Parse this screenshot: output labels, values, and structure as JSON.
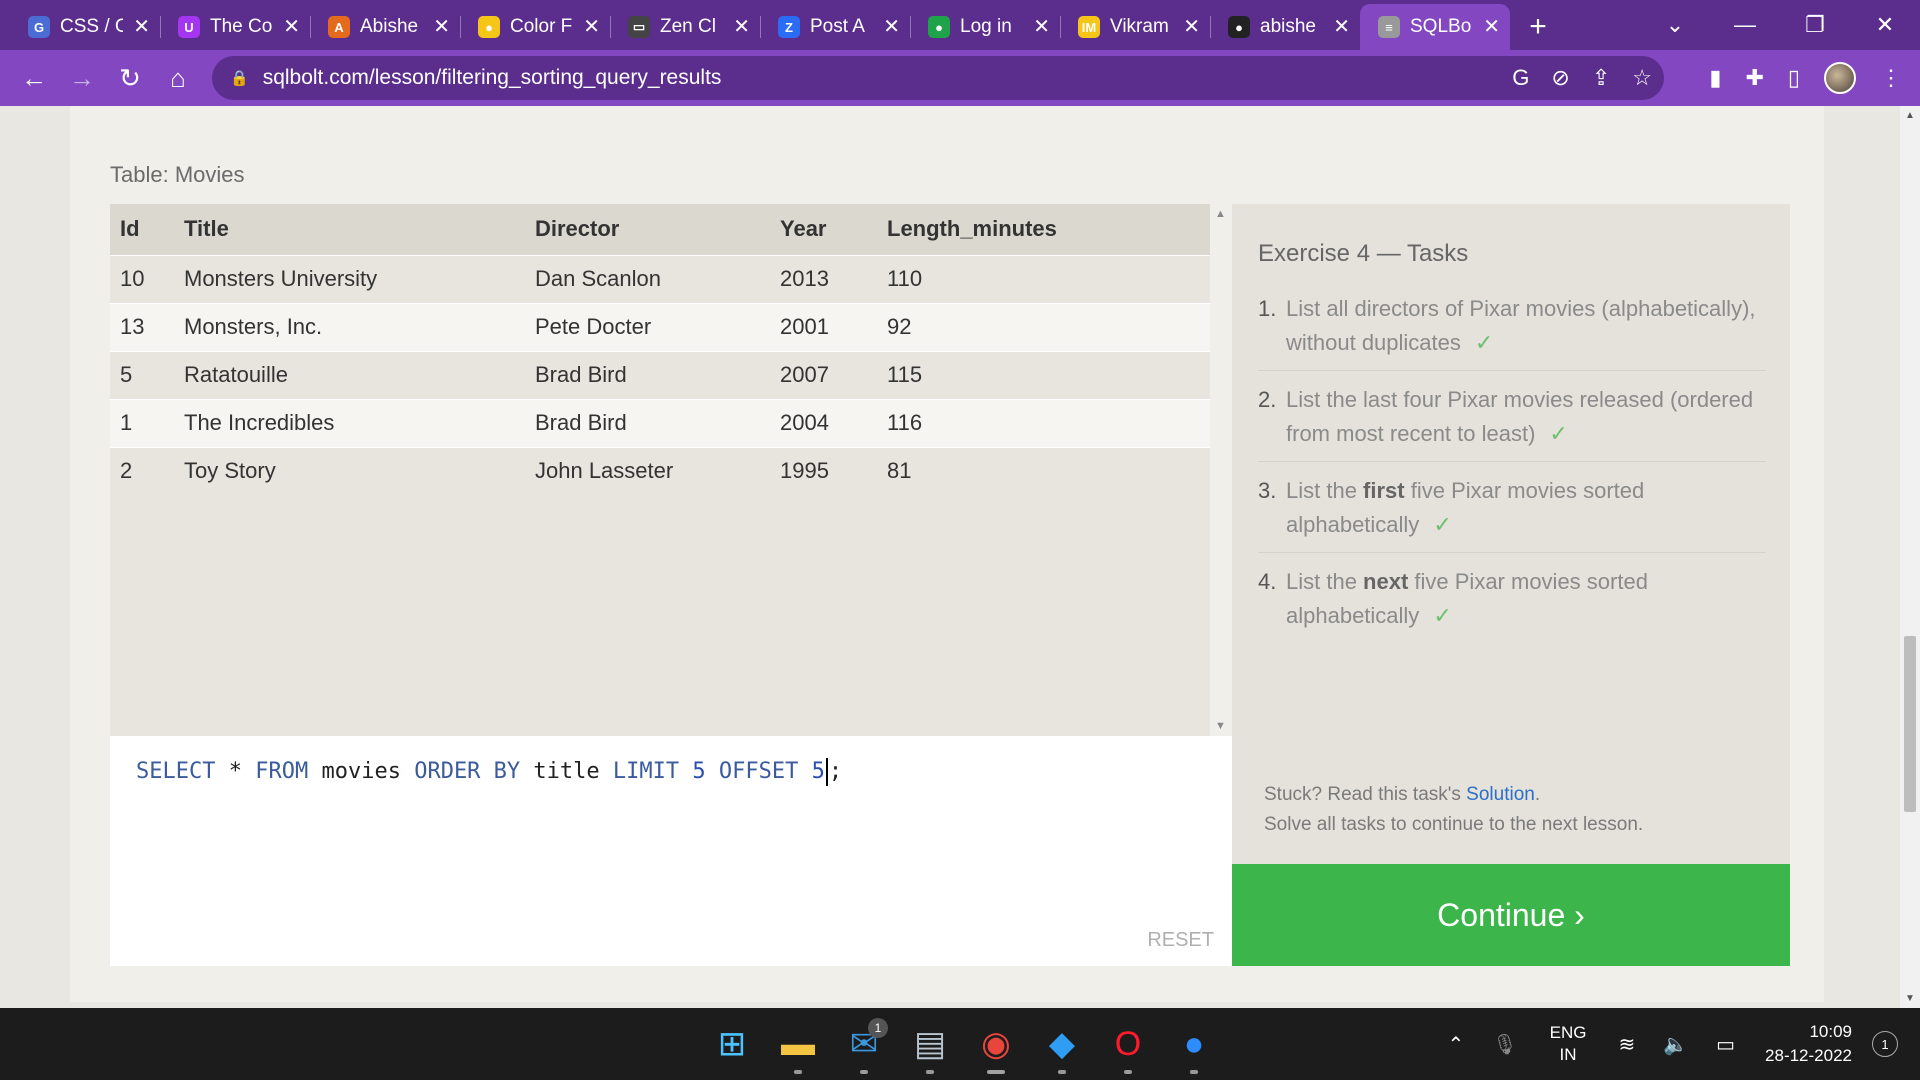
{
  "browser": {
    "tabs": [
      {
        "title": "CSS / C",
        "icon": "google-translate-icon",
        "color": "#4a6cd4",
        "glyph": "G"
      },
      {
        "title": "The Co",
        "icon": "udemy-icon",
        "color": "#a435f0",
        "glyph": "U"
      },
      {
        "title": "Abishe",
        "icon": "letter-a-icon",
        "color": "#e46a1c",
        "glyph": "A"
      },
      {
        "title": "Color F",
        "icon": "color-palette-icon",
        "color": "#f5c518",
        "glyph": "●"
      },
      {
        "title": "Zen Cl",
        "icon": "zen-class-icon",
        "color": "#444444",
        "glyph": "▭"
      },
      {
        "title": "Post A",
        "icon": "zoho-z-icon",
        "color": "#2a6df4",
        "glyph": "Z"
      },
      {
        "title": "Log in",
        "icon": "mongodb-leaf-icon",
        "color": "#1fa34a",
        "glyph": "●"
      },
      {
        "title": "Vikram",
        "icon": "imdb-icon",
        "color": "#f5c518",
        "glyph": "IM"
      },
      {
        "title": "abishe",
        "icon": "github-icon",
        "color": "#222222",
        "glyph": "●"
      },
      {
        "title": "SQLBo",
        "icon": "database-icon",
        "color": "#999999",
        "glyph": "≡"
      }
    ],
    "url": "sqlbolt.com/lesson/filtering_sorting_query_results"
  },
  "page": {
    "table_label": "Table: Movies",
    "columns": [
      "Id",
      "Title",
      "Director",
      "Year",
      "Length_minutes"
    ],
    "rows": [
      [
        "10",
        "Monsters University",
        "Dan Scanlon",
        "2013",
        "110"
      ],
      [
        "13",
        "Monsters, Inc.",
        "Pete Docter",
        "2001",
        "92"
      ],
      [
        "5",
        "Ratatouille",
        "Brad Bird",
        "2007",
        "115"
      ],
      [
        "1",
        "The Incredibles",
        "Brad Bird",
        "2004",
        "116"
      ],
      [
        "2",
        "Toy Story",
        "John Lasseter",
        "1995",
        "81"
      ]
    ],
    "query": {
      "kw_select": "SELECT",
      "star": "*",
      "kw_from": "FROM",
      "table": "movies",
      "kw_order_by": "ORDER BY",
      "column": "title",
      "kw_limit": "LIMIT",
      "limit_value": "5",
      "kw_offset": "OFFSET",
      "offset_value": "5",
      "terminator": ";"
    },
    "reset_label": "RESET",
    "exercise": {
      "title": "Exercise 4 — Tasks",
      "tasks": [
        {
          "num": "1.",
          "before": "List all directors of Pixar movies (alphabetically), without duplicates",
          "bold": "",
          "after": "",
          "check": "✓"
        },
        {
          "num": "2.",
          "before": "List the last four Pixar movies released (ordered from most recent to least)",
          "bold": "",
          "after": "",
          "check": "✓"
        },
        {
          "num": "3.",
          "before": "List the ",
          "bold": "first",
          "after": " five Pixar movies sorted alphabetically",
          "check": "✓"
        },
        {
          "num": "4.",
          "before": "List the ",
          "bold": "next",
          "after": " five Pixar movies sorted alphabetically",
          "check": "✓"
        }
      ],
      "stuck_text": "Stuck? Read this task's ",
      "solution_link": "Solution",
      "stuck_period": ".",
      "solve_text": "Solve all tasks to continue to the next lesson.",
      "continue_label": "Continue ›"
    }
  },
  "taskbar": {
    "apps": [
      {
        "name": "windows-start-icon",
        "glyph": "⊞",
        "color": "#4cc2ff"
      },
      {
        "name": "file-explorer-icon",
        "glyph": "▬",
        "color": "#f4c542"
      },
      {
        "name": "mail-icon",
        "glyph": "✉",
        "color": "#3a96dd",
        "badge": "1"
      },
      {
        "name": "keyboard-app-icon",
        "glyph": "▤",
        "color": "#b8c4d0"
      },
      {
        "name": "chrome-icon",
        "glyph": "◉",
        "color": "#e8453c"
      },
      {
        "name": "vscode-icon",
        "glyph": "◆",
        "color": "#2f9df4"
      },
      {
        "name": "opera-icon",
        "glyph": "O",
        "color": "#ff1b2d"
      },
      {
        "name": "zoom-icon",
        "glyph": "●",
        "color": "#2d8cff"
      }
    ],
    "lang_primary": "ENG",
    "lang_secondary": "IN",
    "time": "10:09",
    "date": "28-12-2022",
    "notification_count": "1"
  },
  "colors": {
    "tab_strip": "#5b2e8e",
    "toolbar": "#8247c1",
    "continue": "#3cb54a",
    "link": "#2b6fc8"
  }
}
